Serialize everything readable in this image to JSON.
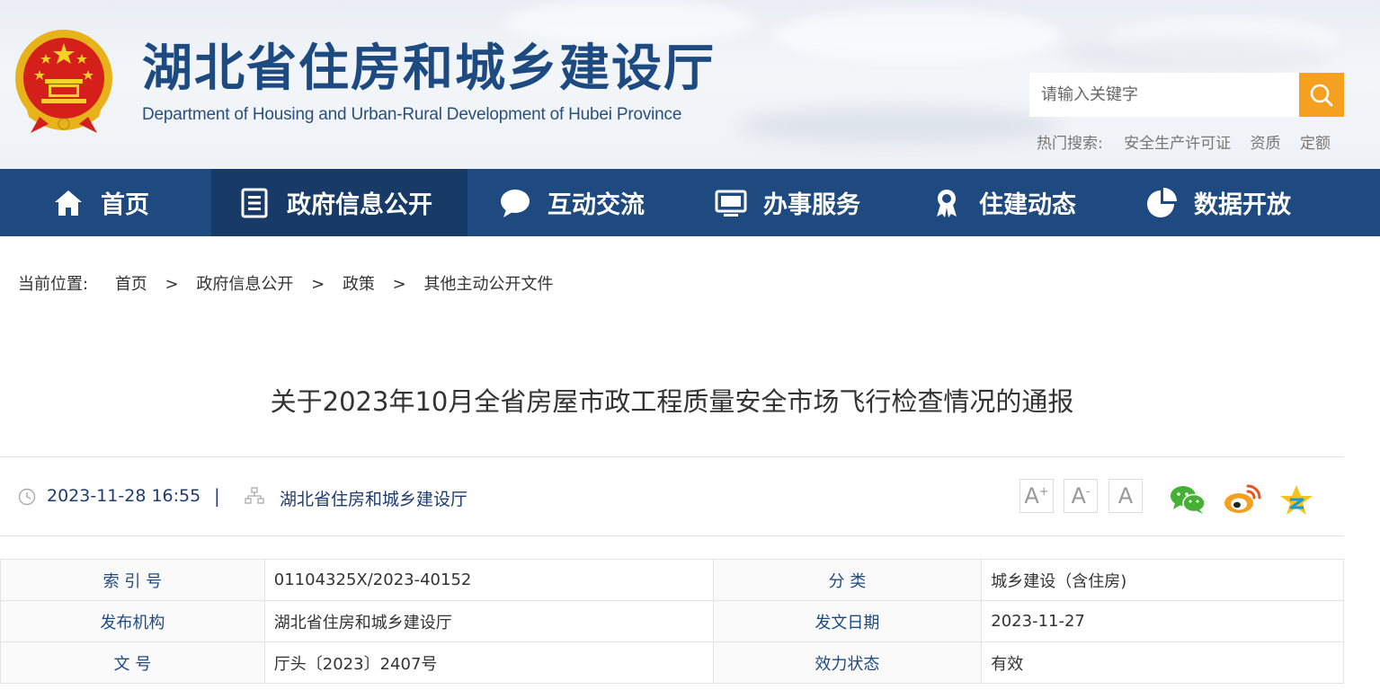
{
  "header": {
    "title": "湖北省住房和城乡建设厅",
    "subtitle": "Department of Housing and Urban-Rural Development of Hubei Province",
    "search_placeholder": "请输入关键字",
    "hot_label": "热门搜索:",
    "hot_terms": [
      "安全生产许可证",
      "资质",
      "定额"
    ]
  },
  "nav": {
    "items": [
      {
        "label": "首页",
        "icon": "home-icon"
      },
      {
        "label": "政府信息公开",
        "icon": "document-list-icon"
      },
      {
        "label": "互动交流",
        "icon": "chat-bubble-icon"
      },
      {
        "label": "办事服务",
        "icon": "monitor-icon"
      },
      {
        "label": "住建动态",
        "icon": "award-badge-icon"
      },
      {
        "label": "数据开放",
        "icon": "pie-chart-icon"
      }
    ],
    "active": "政府信息公开"
  },
  "breadcrumb": {
    "label": "当前位置:",
    "items": [
      "首页",
      "政府信息公开",
      "政策",
      "其他主动公开文件"
    ],
    "separator": ">"
  },
  "article": {
    "title": "关于2023年10月全省房屋市政工程质量安全市场飞行检查情况的通报",
    "datetime": "2023-11-28 16:55",
    "divider": "|",
    "source": "湖北省住房和城乡建设厅"
  },
  "font_controls": [
    "A",
    "A",
    "A"
  ],
  "share_icons": [
    "wechat-icon",
    "weibo-icon",
    "qzone-icon"
  ],
  "info_table": {
    "rows": [
      {
        "k1": "索 引 号",
        "v1": "01104325X/2023-40152",
        "k2": "分 类",
        "v2": "城乡建设（含住房)"
      },
      {
        "k1": "发布机构",
        "v1": "湖北省住房和城乡建设厅",
        "k2": "发文日期",
        "v2": "2023-11-27"
      },
      {
        "k1": "文 号",
        "v1": "厅头〔2023〕2407号",
        "k2": "效力状态",
        "v2": "有效"
      }
    ]
  },
  "colors": {
    "nav_bg": "#1f4a80",
    "nav_active": "#173a66",
    "title_blue": "#1e4a82",
    "search_btn": "#f5a020"
  }
}
